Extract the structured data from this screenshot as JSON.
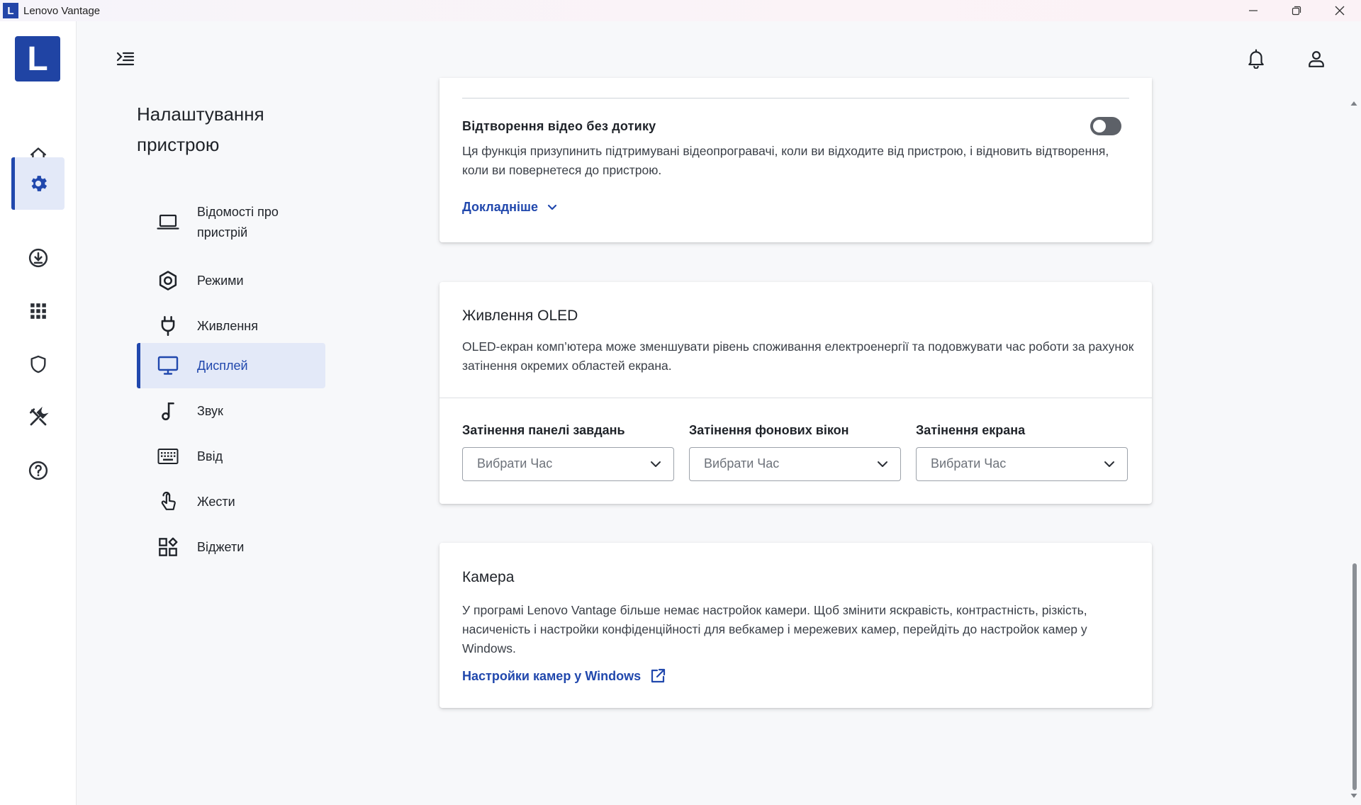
{
  "window": {
    "app_logo_letter": "L",
    "title": "Lenovo Vantage"
  },
  "rail": {
    "logo_letter": "L",
    "items": [
      {
        "icon": "home-icon",
        "active": false
      },
      {
        "icon": "gear-icon",
        "active": true
      },
      {
        "icon": "download-icon",
        "active": false
      },
      {
        "icon": "apps-grid-icon",
        "active": false
      },
      {
        "icon": "shield-icon",
        "active": false
      },
      {
        "icon": "tools-icon",
        "active": false
      },
      {
        "icon": "help-icon",
        "active": false
      }
    ]
  },
  "settings_nav": {
    "title_line1": "Налаштування",
    "title_line2": "пристрою",
    "items": [
      {
        "label": "Відомості про пристрій",
        "icon": "laptop-icon"
      },
      {
        "label": "Режими",
        "icon": "hexagon-icon"
      },
      {
        "label": "Живлення",
        "icon": "plug-icon"
      },
      {
        "label": "Дисплей",
        "icon": "monitor-icon",
        "active": true
      },
      {
        "label": "Звук",
        "icon": "music-note-icon"
      },
      {
        "label": "Ввід",
        "icon": "keyboard-icon"
      },
      {
        "label": "Жести",
        "icon": "touch-hand-icon"
      },
      {
        "label": "Віджети",
        "icon": "widgets-icon"
      }
    ]
  },
  "video_card": {
    "title": "Відтворення відео без дотику",
    "toggle_on": false,
    "description": "Ця функція призупинить підтримувані відеопрогравачі, коли ви відходите від пристрою, і відновить відтворення, коли ви повернетеся до пристрою.",
    "more_link": "Докладніше"
  },
  "oled_card": {
    "title": "Живлення OLED",
    "description": "OLED-екран комп’ютера може зменшувати рівень споживання електроенергії та подовжувати час роботи за рахунок затінення окремих областей екрана.",
    "selects": [
      {
        "label": "Затінення панелі завдань",
        "placeholder": "Вибрати Час"
      },
      {
        "label": "Затінення фонових вікон",
        "placeholder": "Вибрати Час"
      },
      {
        "label": "Затінення екрана",
        "placeholder": "Вибрати Час"
      }
    ]
  },
  "camera_card": {
    "title": "Камера",
    "description": "У програмі Lenovo Vantage більше немає настройок камери. Щоб змінити яскравість, контрастність, різкість, насиченість і настройки конфіденційності для вебкамер і мережевих камер, перейдіть до настройок камер у Windows.",
    "link": "Настройки камер у Windows"
  },
  "colors": {
    "accent": "#2148ad",
    "brand_logo": "#2044a4"
  }
}
